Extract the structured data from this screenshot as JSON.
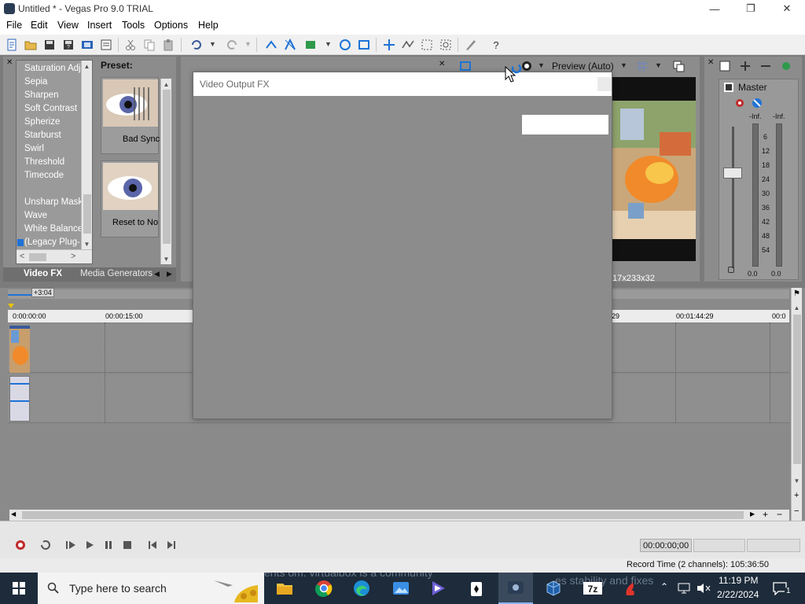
{
  "window": {
    "title": "Untitled * - Vegas Pro 9.0 TRIAL",
    "minimize": "—",
    "maximize": "❐",
    "close": "✕"
  },
  "menu": [
    "File",
    "Edit",
    "View",
    "Insert",
    "Tools",
    "Options",
    "Help"
  ],
  "fx_list": {
    "items": [
      "Saturation Adj",
      "Sepia",
      "Sharpen",
      "Soft Contrast",
      "Spherize",
      "Starburst",
      "Swirl",
      "Threshold",
      "Timecode",
      "",
      "Unsharp Mask",
      "Wave",
      "White Balance",
      "(Legacy Plug-I"
    ]
  },
  "preset": {
    "label": "Preset:",
    "items": [
      "Bad Sync",
      "Reset to No"
    ]
  },
  "tabs": {
    "video_fx": "Video FX",
    "media_generators": "Media Generators"
  },
  "preview": {
    "mode": "Preview (Auto)",
    "info": "17x233x32"
  },
  "mixer": {
    "title": "Master",
    "inf_left": "-Inf.",
    "inf_right": "-Inf.",
    "scale": [
      "6",
      "12",
      "18",
      "24",
      "30",
      "36",
      "42",
      "48",
      "54"
    ],
    "value_left": "0.0",
    "value_right": "0.0"
  },
  "timeline": {
    "marker": "+3:04",
    "ruler": [
      "0:00:00:00",
      "00:00:15:00",
      "29",
      "00:01:44:29",
      "00:0"
    ]
  },
  "transport": {
    "timecode": "00:00:00;00"
  },
  "status": {
    "record_time": "Record Time (2 channels): 105:36:50"
  },
  "dialog": {
    "title": "Video Output FX"
  },
  "taskbar": {
    "search_placeholder": "Type here to search",
    "time": "11:19 PM",
    "date": "2/22/2024",
    "notification_count": "1",
    "behind_text_1": "ents om. virtualbox is a community",
    "behind_text_2": "es stability and fixes"
  },
  "colors": {
    "workspace": "#7b7b7b",
    "taskbar": "#1d2b3a",
    "accent_blue": "#1e73d6"
  }
}
